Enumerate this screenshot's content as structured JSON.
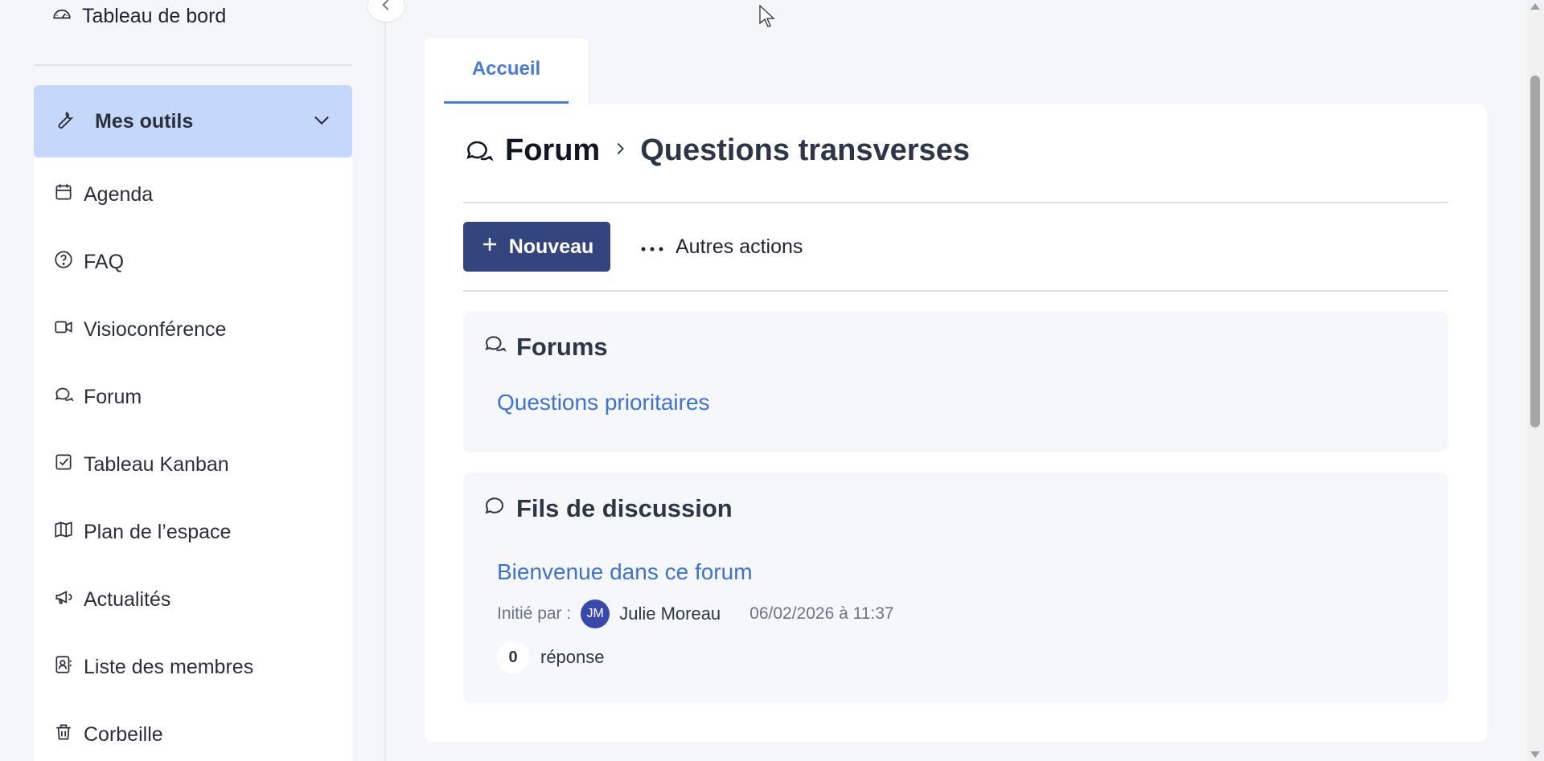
{
  "sidebar": {
    "dashboard_label": "Tableau de bord",
    "tools_header": "Mes outils",
    "items": [
      {
        "label": "Agenda",
        "icon": "calendar-icon"
      },
      {
        "label": "FAQ",
        "icon": "question-circle-icon"
      },
      {
        "label": "Visioconférence",
        "icon": "video-icon"
      },
      {
        "label": "Forum",
        "icon": "forum-icon"
      },
      {
        "label": "Tableau Kanban",
        "icon": "checkbox-icon"
      },
      {
        "label": "Plan de l’espace",
        "icon": "map-icon"
      },
      {
        "label": "Actualités",
        "icon": "megaphone-icon"
      },
      {
        "label": "Liste des membres",
        "icon": "contacts-icon"
      },
      {
        "label": "Corbeille",
        "icon": "trash-icon"
      }
    ]
  },
  "tabs": [
    {
      "label": "Accueil",
      "active": true
    }
  ],
  "breadcrumb": {
    "root": "Forum",
    "current": "Questions transverses"
  },
  "toolbar": {
    "new_label": "Nouveau",
    "more_label": "Autres actions"
  },
  "forums": {
    "title": "Forums",
    "items": [
      {
        "label": "Questions prioritaires"
      }
    ]
  },
  "threads": {
    "title": "Fils de discussion",
    "items": [
      {
        "title": "Bienvenue dans ce forum",
        "initiated_by_label": "Initié par :",
        "author_initials": "JM",
        "author": "Julie Moreau",
        "date": "06/02/2026 à 11:37",
        "reply_count": "0",
        "reply_label": "réponse"
      }
    ]
  },
  "colors": {
    "accent": "#4a7bd6",
    "primary_button": "#33447f",
    "sidebar_active": "#c5d7fb",
    "avatar": "#3949ab"
  }
}
